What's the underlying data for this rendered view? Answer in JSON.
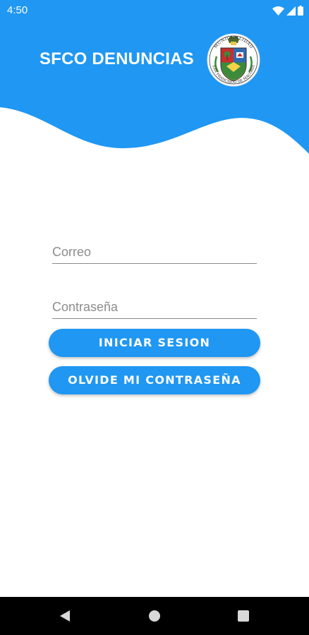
{
  "status_bar": {
    "time": "4:50",
    "icons": [
      "wifi-icon",
      "signal-icon",
      "battery-icon"
    ]
  },
  "header": {
    "title": "SFCO DENUNCIAS",
    "logo": {
      "icon": "municipal-coat-of-arms-icon",
      "top_text": "MUNICIPALIDAD",
      "bottom_text": "SAN FRANCISCO DE MACORIS"
    }
  },
  "form": {
    "email_placeholder": "Correo",
    "email_value": "",
    "password_placeholder": "Contraseña",
    "password_value": "",
    "login_label": "INICIAR SESION",
    "forgot_label": "OLVIDE MI CONTRASEÑA"
  },
  "nav_bar": {
    "icons": [
      "back-icon",
      "home-icon",
      "recents-icon"
    ]
  },
  "colors": {
    "primary": "#1f97f3",
    "header": "#1f97f3",
    "background": "#ffffff",
    "nav_bar": "#000000"
  }
}
